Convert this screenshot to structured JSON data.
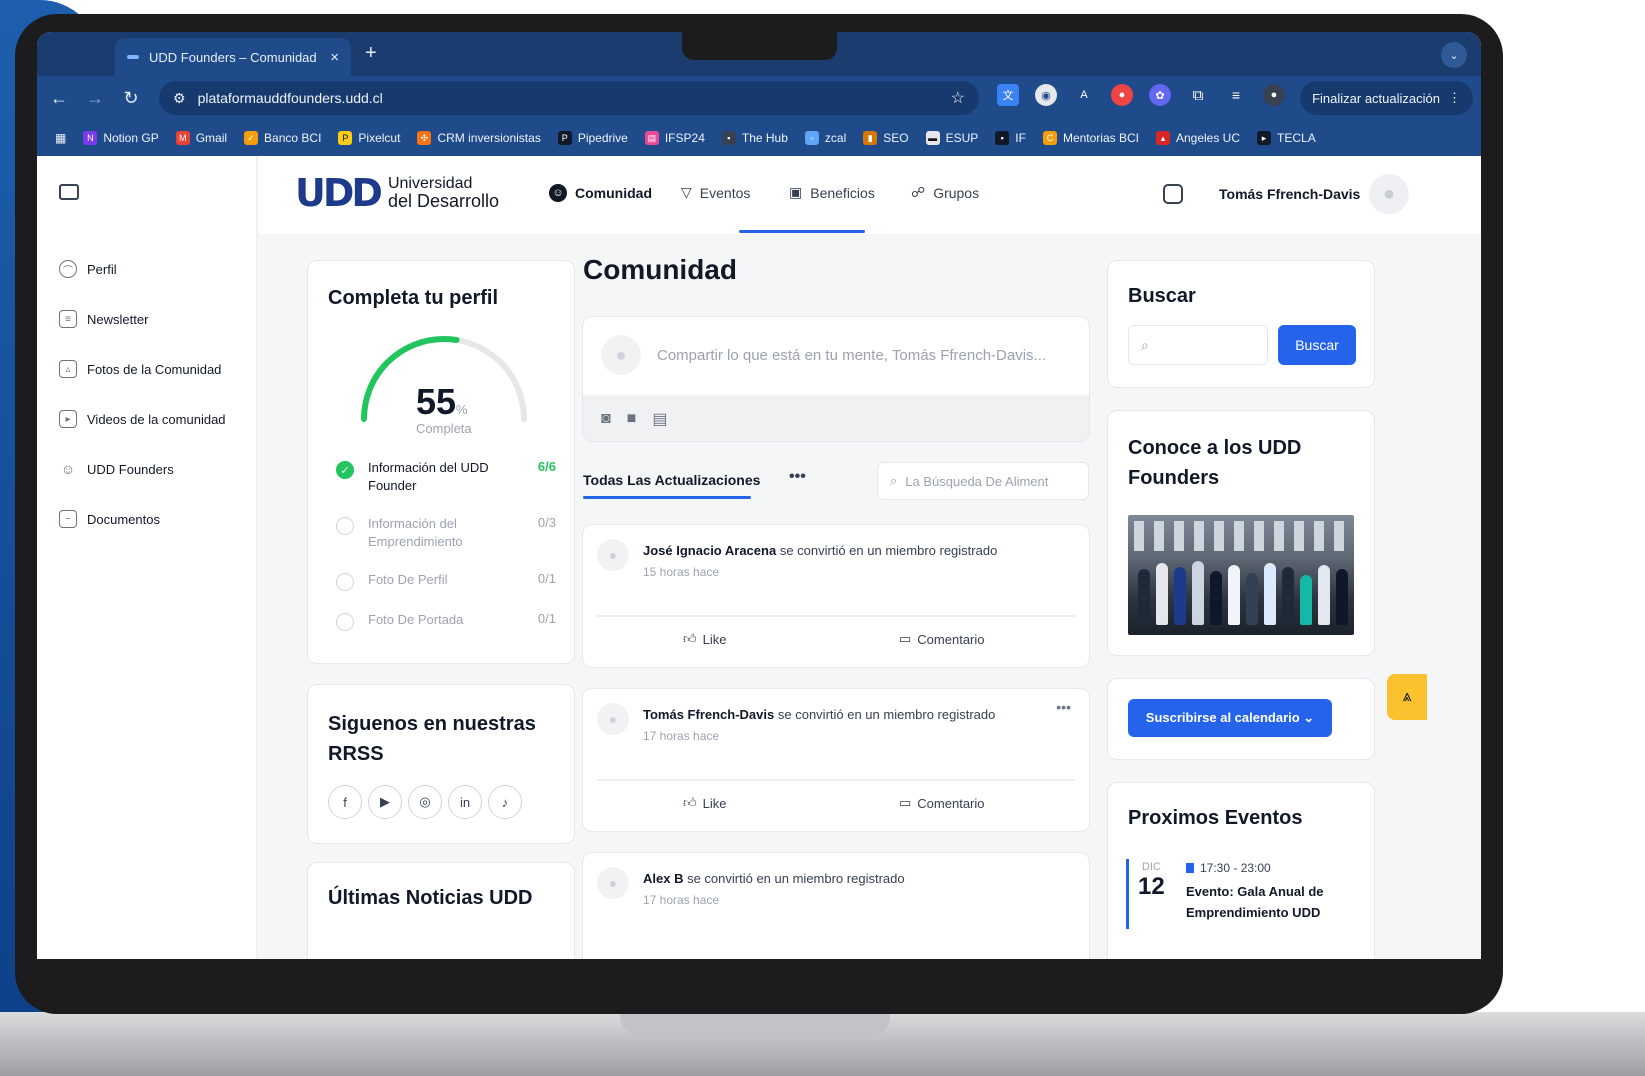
{
  "browser": {
    "tab_title": "UDD Founders – Comunidad",
    "tab_close": "×",
    "new_tab": "+",
    "url": "plataformauddfounders.udd.cl",
    "update_label": "Finalizar actualización",
    "bookmarks": [
      "Notion GP",
      "Gmail",
      "Banco BCI",
      "Pixelcut",
      "CRM inversionistas",
      "Pipedrive",
      "IFSP24",
      "The Hub",
      "zcal",
      "SEO",
      "ESUP",
      "IF",
      "Mentorias BCI",
      "Angeles UC",
      "TECLA"
    ]
  },
  "sidebar": {
    "items": [
      {
        "label": "Perfil",
        "icon": "user-icon"
      },
      {
        "label": "Newsletter",
        "icon": "newspaper-icon"
      },
      {
        "label": "Fotos de la Comunidad",
        "icon": "image-icon"
      },
      {
        "label": "Videos de la comunidad",
        "icon": "video-icon"
      },
      {
        "label": "UDD Founders",
        "icon": "users-icon"
      },
      {
        "label": "Documentos",
        "icon": "document-icon"
      }
    ]
  },
  "header": {
    "logo_mark": "UDD",
    "logo_line1": "Universidad",
    "logo_line2": "del Desarrollo",
    "nav": [
      {
        "label": "Comunidad",
        "icon": "smile-icon",
        "active": true
      },
      {
        "label": "Eventos",
        "icon": "trophy-icon",
        "active": false
      },
      {
        "label": "Beneficios",
        "icon": "gift-icon",
        "active": false
      },
      {
        "label": "Grupos",
        "icon": "group-icon",
        "active": false
      }
    ],
    "username": "Tomás Ffrench-Davis"
  },
  "profile": {
    "title": "Completa tu perfil",
    "percent": 55,
    "percent_label": "55",
    "percent_unit": "%",
    "sub": "Completa",
    "accent": "#22c55e",
    "tasks": [
      {
        "label": "Información del UDD Founder",
        "count": "6/6",
        "done": true
      },
      {
        "label": "Información del Emprendimiento",
        "count": "0/3",
        "done": false
      },
      {
        "label": "Foto De Perfil",
        "count": "0/1",
        "done": false
      },
      {
        "label": "Foto De Portada",
        "count": "0/1",
        "done": false
      }
    ]
  },
  "social": {
    "title": "Siguenos en nuestras RRSS",
    "icons": [
      "facebook-icon",
      "youtube-icon",
      "instagram-icon",
      "linkedin-icon",
      "tiktok-icon"
    ]
  },
  "news": {
    "title": "Últimas Noticias UDD"
  },
  "feed": {
    "title": "Comunidad",
    "composer_placeholder": "Compartir lo que está en tu mente, Tomás Ffrench-Davis...",
    "tab_label": "Todas Las Actualizaciones",
    "more": "•••",
    "search_placeholder": "La Búsqueda De Aliment",
    "posts": [
      {
        "name": "José Ignacio Aracena",
        "action": "se convirtió en un miembro registrado",
        "time": "15 horas hace",
        "like": "Like",
        "comment": "Comentario"
      },
      {
        "name": "Tomás Ffrench-Davis",
        "action": "se convirtió en un miembro registrado",
        "time": "17 horas hace",
        "like": "Like",
        "comment": "Comentario"
      },
      {
        "name": "Alex B",
        "action": "se convirtió en un miembro registrado",
        "time": "17 horas hace"
      }
    ]
  },
  "search": {
    "title": "Buscar",
    "button": "Buscar"
  },
  "founders": {
    "title": "Conoce a los UDD Founders"
  },
  "calendar": {
    "button": "Suscribirse al calendario ⌄"
  },
  "events": {
    "title": "Proximos Eventos",
    "month": "DIC",
    "day": "12",
    "time": "17:30 - 23:00",
    "event_title": "Evento: Gala Anual de Emprendimiento UDD"
  },
  "colors": {
    "brand": "#1e3a8a",
    "accent": "#2563eb",
    "chrome": "#1f4b8a",
    "fab": "#f9c22e"
  }
}
